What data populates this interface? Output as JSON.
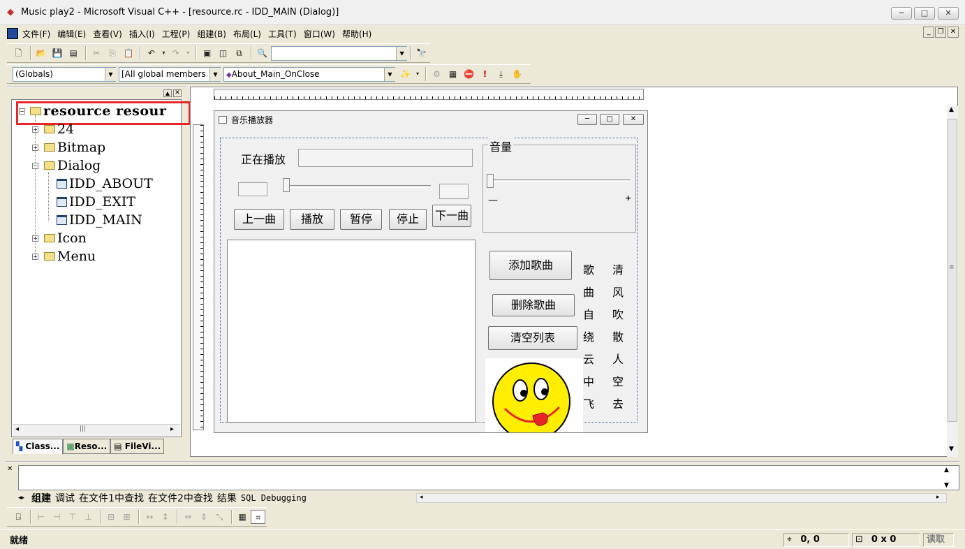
{
  "window": {
    "title": "Music play2 - Microsoft Visual C++ - [resource.rc - IDD_MAIN (Dialog)]",
    "min": "─",
    "max": "□",
    "close": "✕"
  },
  "menu": {
    "items": [
      "文件(F)",
      "编辑(E)",
      "查看(V)",
      "插入(I)",
      "工程(P)",
      "组建(B)",
      "布局(L)",
      "工具(T)",
      "窗口(W)",
      "帮助(H)"
    ],
    "mdi_min": "_",
    "mdi_restore": "❐",
    "mdi_close": "✕"
  },
  "toolbar2": {
    "scope": "(Globals)",
    "members": "[All global members",
    "function": "About_Main_OnClose"
  },
  "tree": {
    "root": "resource resour",
    "items": [
      {
        "label": "24",
        "expander": "+"
      },
      {
        "label": "Bitmap",
        "expander": "+"
      },
      {
        "label": "Dialog",
        "expander": "−"
      },
      {
        "label": "IDD_ABOUT"
      },
      {
        "label": "IDD_EXIT"
      },
      {
        "label": "IDD_MAIN"
      },
      {
        "label": "Icon",
        "expander": "+"
      },
      {
        "label": "Menu",
        "expander": "+"
      }
    ],
    "root_expander": "−",
    "hscroll_left": "◂",
    "hscroll_right": "▸",
    "hscroll_grip": "|||"
  },
  "panel_tabs": [
    "Class...",
    "Reso...",
    "FileVi..."
  ],
  "dialog": {
    "title": "音乐播放器",
    "now_playing_label": "正在播放",
    "volume_group": "音量",
    "volume_min": "—",
    "volume_max": "+",
    "buttons": {
      "prev": "上一曲",
      "play": "播放",
      "pause": "暂停",
      "stop": "停止",
      "next": "下一曲",
      "add": "添加歌曲",
      "delete": "删除歌曲",
      "clear": "清空列表"
    },
    "lyrics_col1": [
      "歌",
      "曲",
      "自",
      "绕",
      "云",
      "中",
      "飞"
    ],
    "lyrics_col2": [
      "清",
      "风",
      "吹",
      "散",
      "人",
      "空",
      "去"
    ]
  },
  "output_tabs": [
    "组建",
    "调试",
    "在文件1中查找",
    "在文件2中查找",
    "结果",
    "SQL Debugging"
  ],
  "status": {
    "text": "就绪",
    "position": "0, 0",
    "size": "0 x 0",
    "mode": "读取"
  },
  "colors": {
    "highlight_box": "#e8262a",
    "smiley": "#ffee00",
    "smiley_tongue": "#e8262a"
  }
}
